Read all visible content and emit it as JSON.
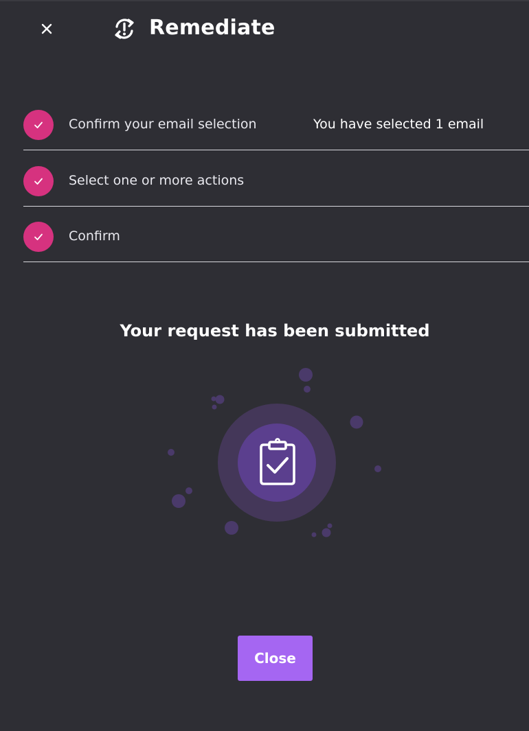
{
  "header": {
    "title": "Remediate",
    "close_icon": "close-icon",
    "title_icon": "remediate-sync-alert-icon"
  },
  "steps": [
    {
      "label": "Confirm your email selection",
      "value": "You have selected 1 email",
      "status": "completed",
      "icon": "check-icon"
    },
    {
      "label": "Select one or more actions",
      "status": "completed",
      "icon": "check-icon"
    },
    {
      "label": "Confirm",
      "status": "completed",
      "icon": "check-icon"
    }
  ],
  "result": {
    "message": "Your request has been submitted",
    "illustration_icon": "clipboard-check-icon"
  },
  "footer": {
    "close_label": "Close"
  },
  "colors": {
    "background": "#2e2e34",
    "step_badge": "#d6327f",
    "primary_button": "#a566f2",
    "illustration_outer": "#473a60",
    "illustration_inner": "#5b3f8e",
    "divider": "#d9d9de"
  }
}
